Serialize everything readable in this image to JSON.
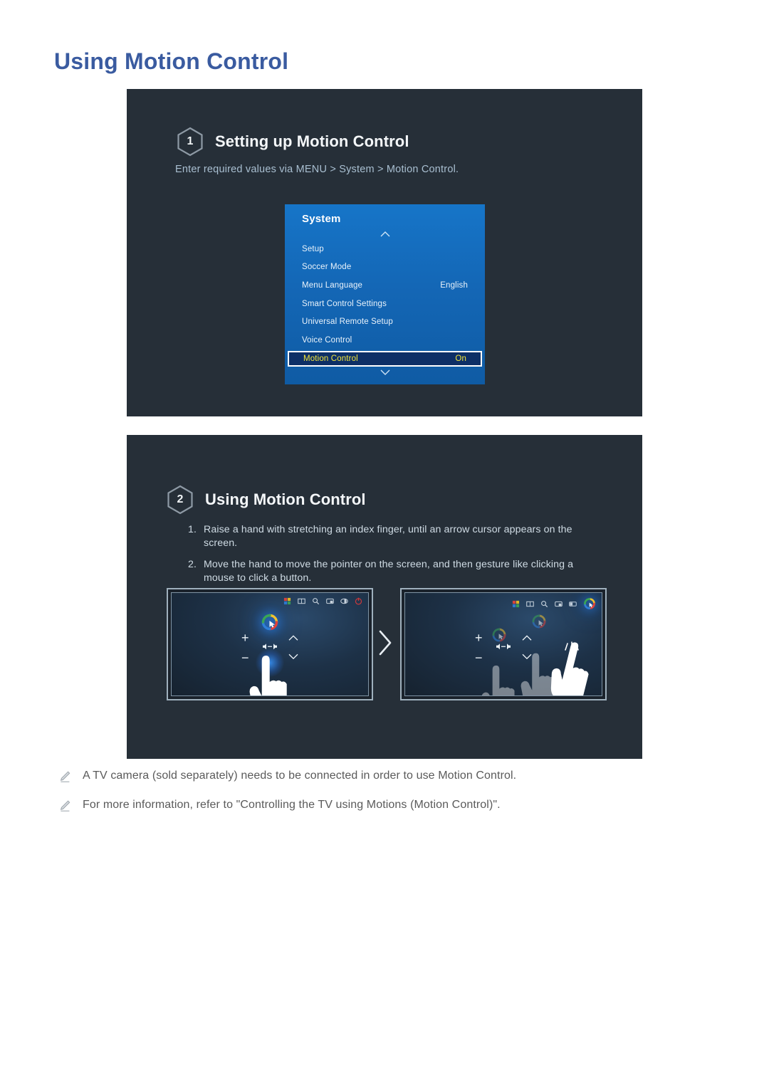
{
  "page": {
    "title": "Using Motion Control",
    "title_color": "#3a5ba0"
  },
  "steps": [
    {
      "number": "1",
      "title": "Setting up Motion Control",
      "path_text": "Enter required values via MENU > System > Motion Control."
    },
    {
      "number": "2",
      "title": "Using Motion Control",
      "instructions": [
        {
          "index": "1.",
          "text": "Raise a hand with stretching an index finger, until an arrow cursor appears on the screen."
        },
        {
          "index": "2.",
          "text": "Move the hand to move the pointer on the screen, and then gesture like clicking a mouse to click a button."
        }
      ]
    }
  ],
  "system_menu": {
    "title": "System",
    "scroll_up_icon": "chevron-up-icon",
    "scroll_down_icon": "chevron-down-icon",
    "highlight_text_color": "#f2e53a",
    "background_color": "#1467b6",
    "rows": [
      {
        "label": "Setup",
        "value": "",
        "selected": false
      },
      {
        "label": "Soccer Mode",
        "value": "",
        "selected": false
      },
      {
        "label": "Menu Language",
        "value": "English",
        "selected": false
      },
      {
        "label": "Smart Control Settings",
        "value": "",
        "selected": false
      },
      {
        "label": "Universal Remote Setup",
        "value": "",
        "selected": false
      },
      {
        "label": "Voice Control",
        "value": "",
        "selected": false
      },
      {
        "label": "Motion Control",
        "value": "On",
        "selected": true
      }
    ]
  },
  "tv_illustrations": {
    "separator_icon": "chevron-right-icon",
    "toolbar_icons": [
      "smart-hub-icon",
      "apps-icon",
      "search-icon",
      "source-icon",
      "picture-mode-icon",
      "power-icon"
    ],
    "toolbar_icons_right": [
      "smart-hub-icon",
      "apps-icon",
      "search-icon",
      "source-icon",
      "picture-mode-icon",
      "cursor-ring-icon"
    ],
    "volume_controls": {
      "volume_up": "+",
      "volume_down": "−",
      "channel_up": "chevron-up-icon",
      "channel_down": "chevron-down-icon",
      "mute": "mute-icon"
    },
    "left": {
      "caption_role": "pointing-hand-moves-cursor",
      "cursor_icon": "motion-cursor-ring-icon"
    },
    "right": {
      "caption_role": "hand-moves-right-and-clicks",
      "cursor_icon": "motion-cursor-ring-icon",
      "click_effect_icon": "click-sparkle-icon"
    }
  },
  "footnotes": [
    {
      "icon": "pencil-icon",
      "text": "A TV camera (sold separately) needs to be connected in order to use Motion Control."
    },
    {
      "icon": "pencil-icon",
      "text": "For more information, refer to \"Controlling the TV using Motions (Motion Control)\"."
    }
  ]
}
